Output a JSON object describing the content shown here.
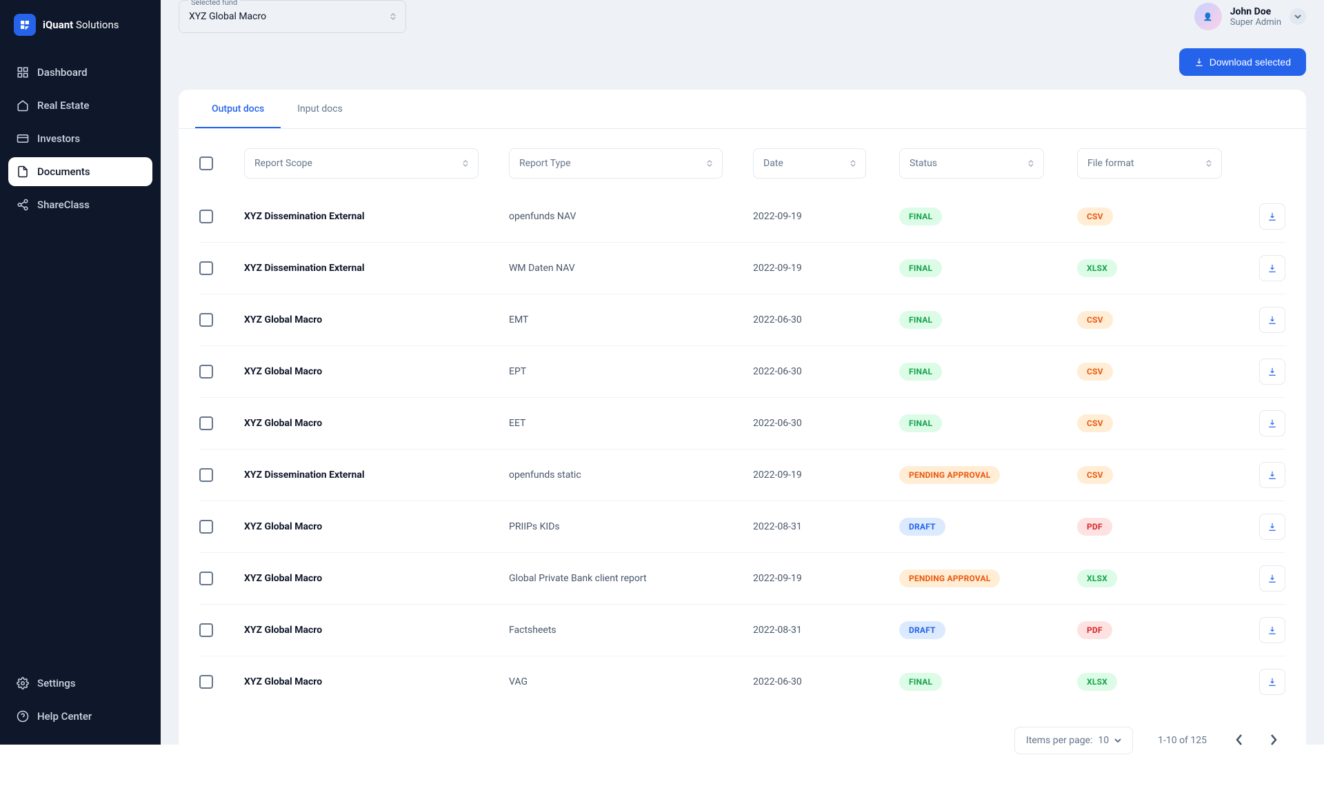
{
  "brand": {
    "name_bold": "iQuant",
    "name_light": "Solutions"
  },
  "sidebar": {
    "items": [
      {
        "label": "Dashboard",
        "icon": "grid"
      },
      {
        "label": "Real Estate",
        "icon": "home"
      },
      {
        "label": "Investors",
        "icon": "card"
      },
      {
        "label": "Documents",
        "icon": "file",
        "active": true
      },
      {
        "label": "ShareClass",
        "icon": "share"
      }
    ],
    "bottom": [
      {
        "label": "Settings",
        "icon": "gear"
      },
      {
        "label": "Help Center",
        "icon": "help"
      }
    ]
  },
  "topbar": {
    "fund_label": "Selected fund",
    "fund_value": "XYZ Global Macro"
  },
  "user": {
    "name": "John Doe",
    "role": "Super Admin"
  },
  "actions": {
    "download_selected": "Download selected"
  },
  "tabs": [
    {
      "label": "Output docs",
      "active": true
    },
    {
      "label": "Input docs",
      "active": false
    }
  ],
  "filters": {
    "scope": "Report Scope",
    "type": "Report Type",
    "date": "Date",
    "status": "Status",
    "format": "File format"
  },
  "status_labels": {
    "FINAL": "FINAL",
    "PENDING": "PENDING APPROVAL",
    "DRAFT": "DRAFT"
  },
  "format_labels": {
    "CSV": "CSV",
    "XLSX": "XLSX",
    "PDF": "PDF"
  },
  "rows": [
    {
      "scope": "XYZ Dissemination External",
      "type": "openfunds NAV",
      "date": "2022-09-19",
      "status": "FINAL",
      "format": "CSV"
    },
    {
      "scope": "XYZ Dissemination External",
      "type": "WM Daten NAV",
      "date": "2022-09-19",
      "status": "FINAL",
      "format": "XLSX"
    },
    {
      "scope": "XYZ Global Macro",
      "type": "EMT",
      "date": "2022-06-30",
      "status": "FINAL",
      "format": "CSV"
    },
    {
      "scope": "XYZ Global Macro",
      "type": "EPT",
      "date": "2022-06-30",
      "status": "FINAL",
      "format": "CSV"
    },
    {
      "scope": "XYZ Global Macro",
      "type": "EET",
      "date": "2022-06-30",
      "status": "FINAL",
      "format": "CSV"
    },
    {
      "scope": "XYZ Dissemination External",
      "type": "openfunds static",
      "date": "2022-09-19",
      "status": "PENDING",
      "format": "CSV"
    },
    {
      "scope": "XYZ Global Macro",
      "type": "PRIIPs KIDs",
      "date": "2022-08-31",
      "status": "DRAFT",
      "format": "PDF"
    },
    {
      "scope": "XYZ Global Macro",
      "type": "Global Private Bank client report",
      "date": "2022-09-19",
      "status": "PENDING",
      "format": "XLSX"
    },
    {
      "scope": "XYZ Global Macro",
      "type": "Factsheets",
      "date": "2022-08-31",
      "status": "DRAFT",
      "format": "PDF"
    },
    {
      "scope": "XYZ Global Macro",
      "type": "VAG",
      "date": "2022-06-30",
      "status": "FINAL",
      "format": "XLSX"
    }
  ],
  "footer": {
    "items_per_page_label": "Items per page:",
    "items_per_page_value": "10",
    "range": "1-10 of 125"
  }
}
